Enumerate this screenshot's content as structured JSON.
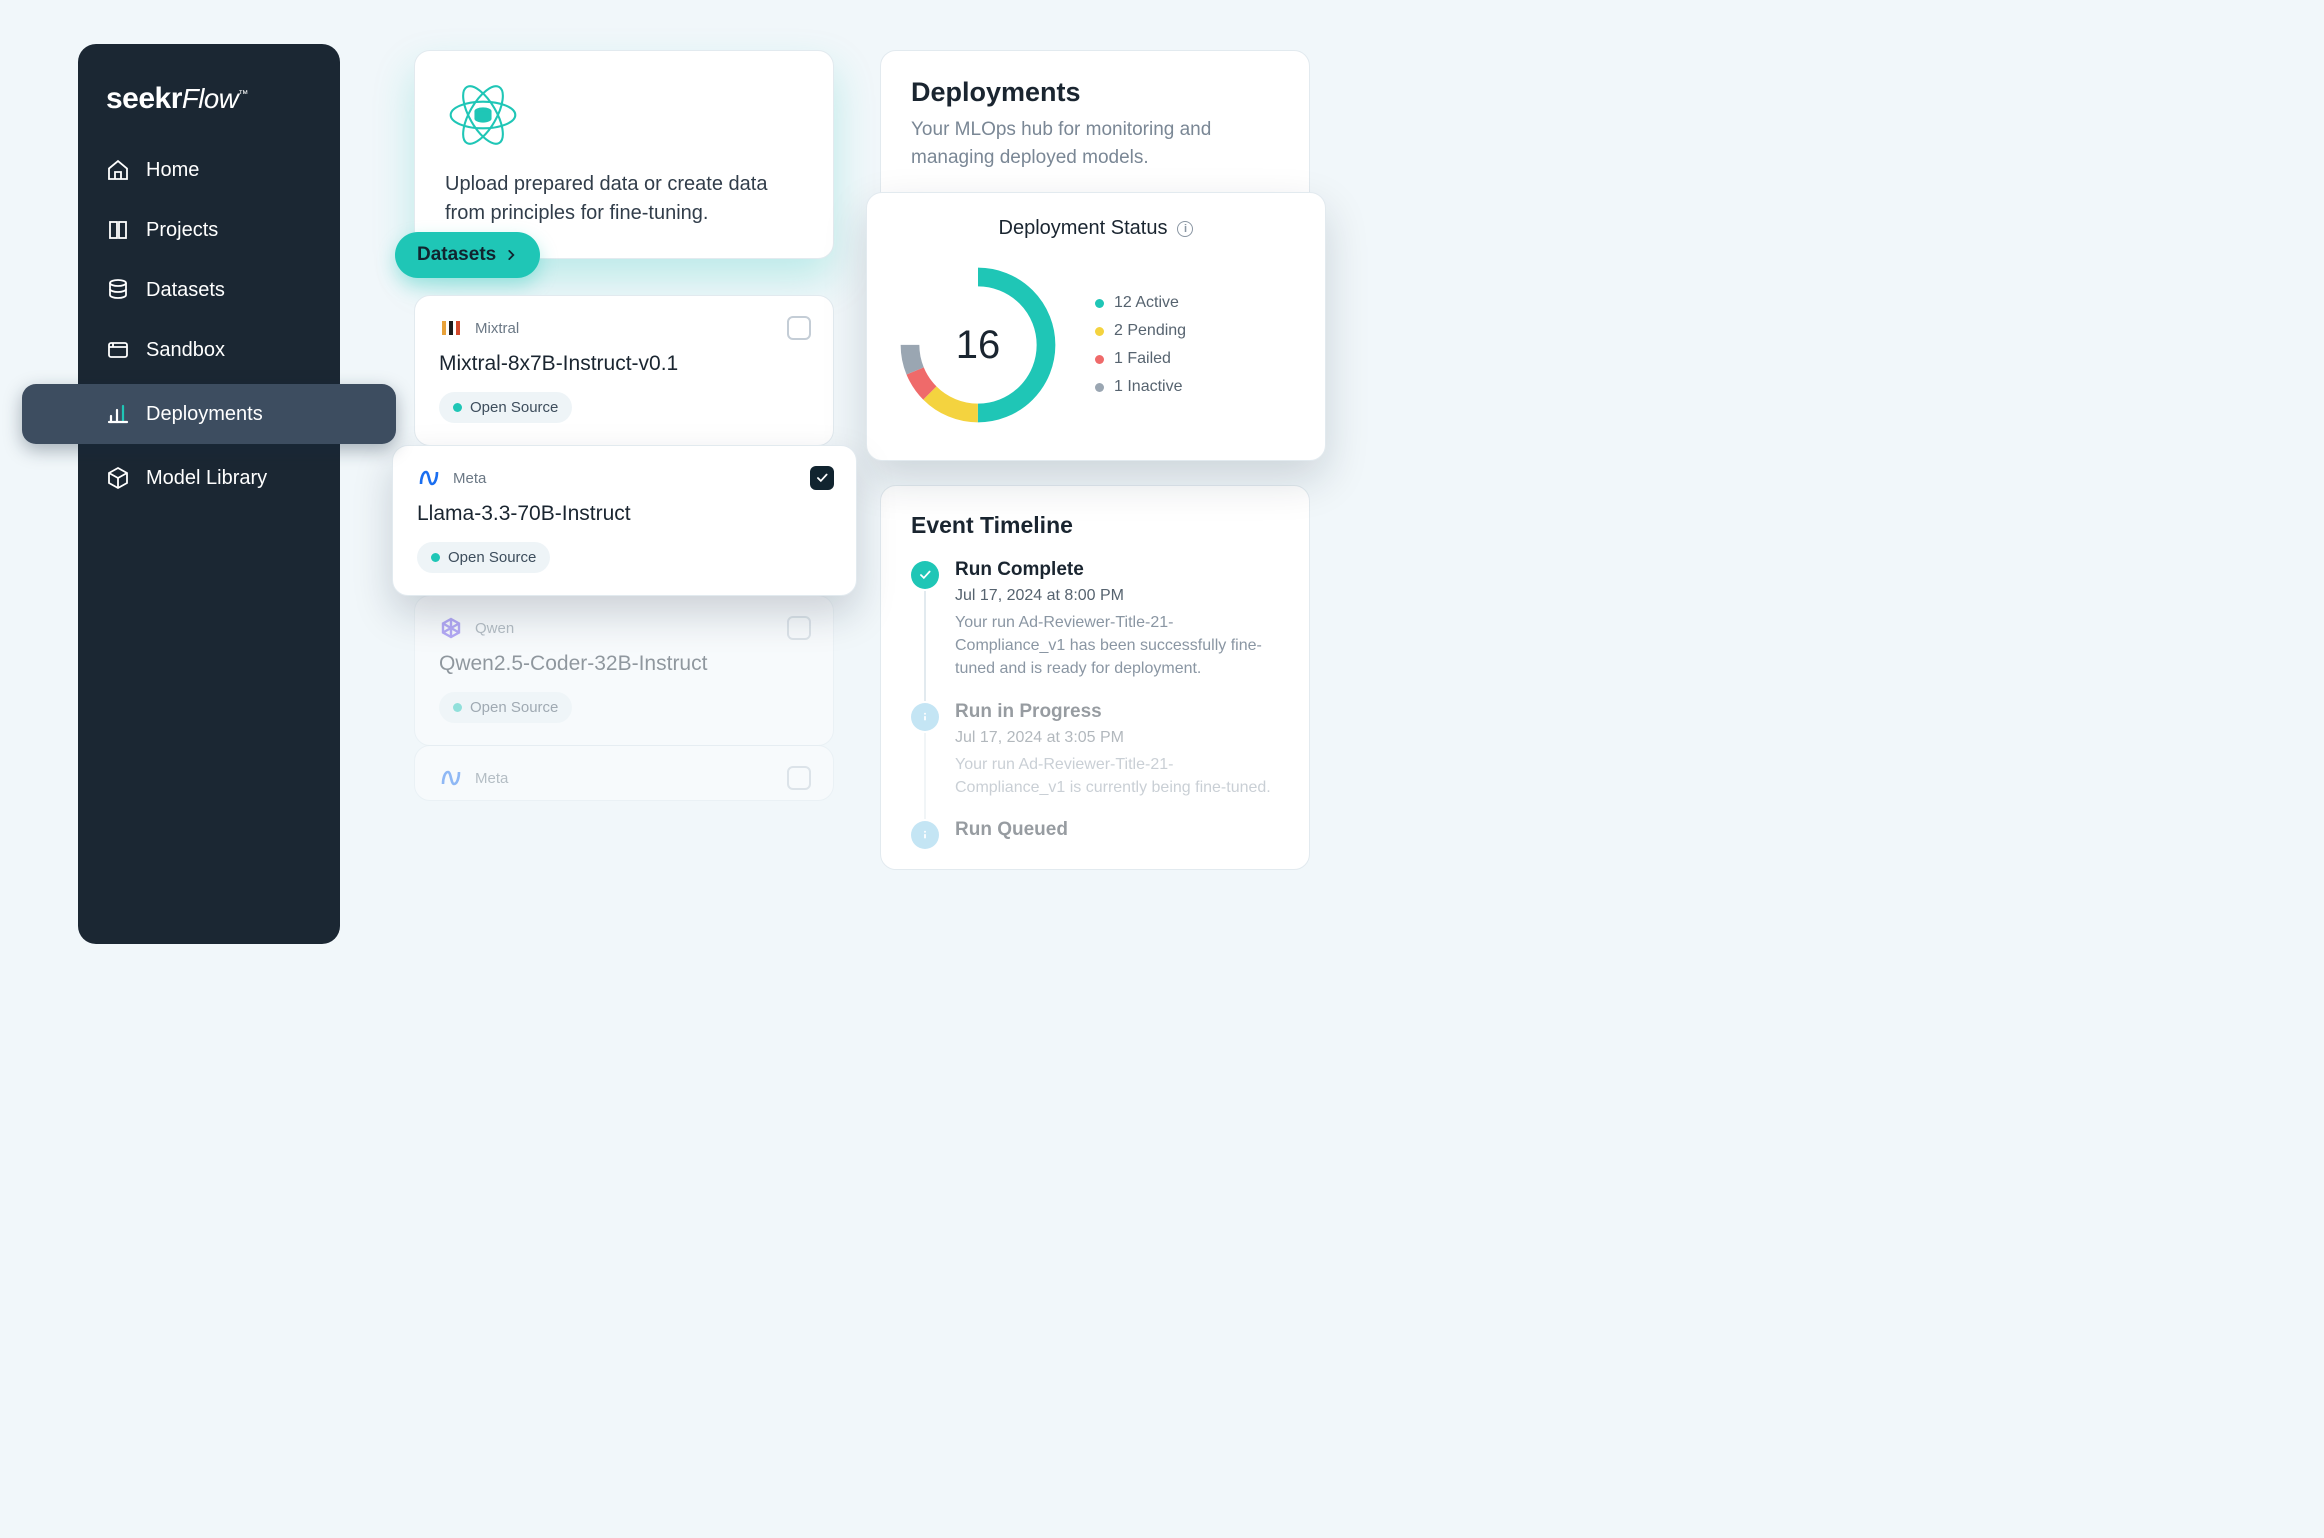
{
  "app": {
    "brand": "seekr",
    "brand2": "Flow",
    "tm": "™"
  },
  "sidebar": {
    "items": [
      {
        "label": "Home"
      },
      {
        "label": "Projects"
      },
      {
        "label": "Datasets"
      },
      {
        "label": "Sandbox"
      },
      {
        "label": "Deployments"
      },
      {
        "label": "Model Library"
      }
    ]
  },
  "datasets_card": {
    "description": "Upload prepared data or create data from principles for fine-tuning.",
    "pill_label": "Datasets"
  },
  "models": [
    {
      "vendor": "Mixtral",
      "name": "Mixtral-8x7B-Instruct-v0.1",
      "badge": "Open Source",
      "selected": false
    },
    {
      "vendor": "Meta",
      "name": "Llama-3.3-70B-Instruct",
      "badge": "Open Source",
      "selected": true
    },
    {
      "vendor": "Qwen",
      "name": "Qwen2.5-Coder-32B-Instruct",
      "badge": "Open Source",
      "selected": false,
      "faded": true
    },
    {
      "vendor": "Meta",
      "name": "",
      "badge": "",
      "selected": false,
      "faded": true
    }
  ],
  "deployments_header": {
    "title": "Deployments",
    "subtitle": "Your MLOps hub for monitoring and managing deployed models."
  },
  "status": {
    "title": "Deployment Status",
    "total": "16",
    "legend": {
      "active": "12 Active",
      "pending": "2 Pending",
      "failed": "1 Failed",
      "inactive": "1 Inactive"
    }
  },
  "chart_data": {
    "type": "pie",
    "title": "Deployment Status",
    "total": 16,
    "series": [
      {
        "name": "Active",
        "value": 12,
        "color": "#1fc6b6"
      },
      {
        "name": "Pending",
        "value": 2,
        "color": "#f4d33f"
      },
      {
        "name": "Failed",
        "value": 1,
        "color": "#ef6a6a"
      },
      {
        "name": "Inactive",
        "value": 1,
        "color": "#9aa6b2"
      }
    ]
  },
  "timeline": {
    "title": "Event Timeline",
    "items": [
      {
        "icon": "ok",
        "title": "Run Complete",
        "timestamp": "Jul 17, 2024 at 8:00 PM",
        "description": "Your run Ad-Reviewer-Title-21-Compliance_v1 has been successfully fine-tuned and is ready for deployment."
      },
      {
        "icon": "info",
        "title": "Run in Progress",
        "timestamp": "Jul 17, 2024 at 3:05 PM",
        "description": "Your run Ad-Reviewer-Title-21-Compliance_v1 is currently being fine-tuned."
      },
      {
        "icon": "info",
        "title": "Run Queued",
        "timestamp": "",
        "description": ""
      }
    ]
  }
}
